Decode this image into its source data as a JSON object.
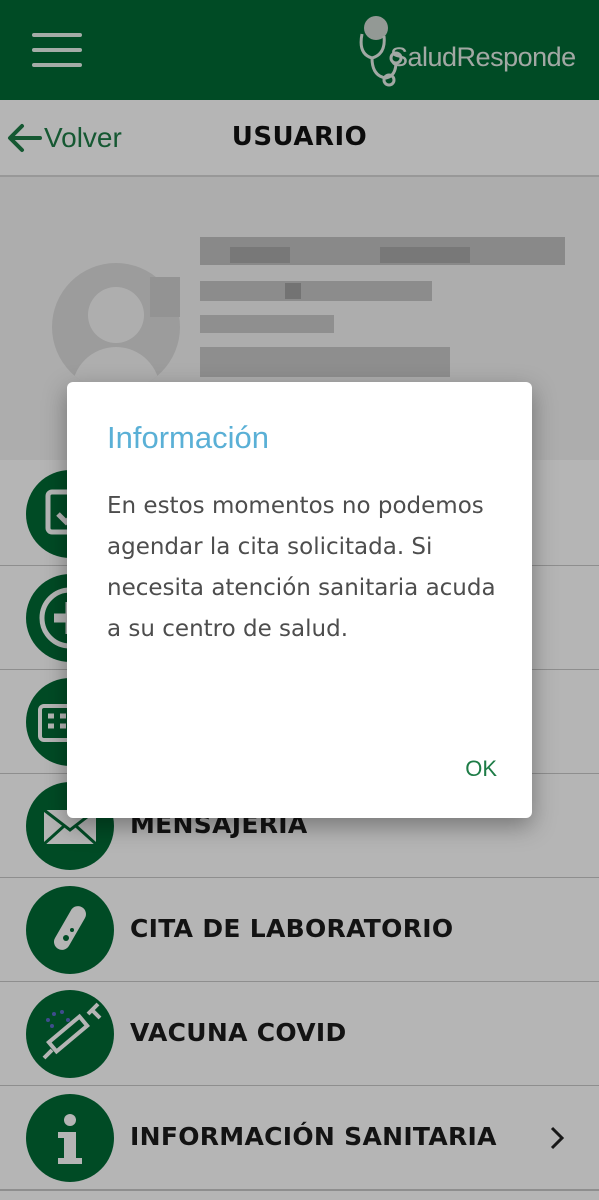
{
  "app": {
    "brand": "SaludResponde"
  },
  "header": {
    "back_label": "Volver",
    "title": "USUARIO"
  },
  "menu": {
    "items": [
      {
        "label": ""
      },
      {
        "label": ""
      },
      {
        "label": ""
      },
      {
        "label": "MENSAJERÍA"
      },
      {
        "label": "CITA DE LABORATORIO"
      },
      {
        "label": "VACUNA COVID"
      },
      {
        "label": "INFORMACIÓN SANITARIA"
      }
    ]
  },
  "dialog": {
    "title": "Información",
    "message": "En estos momentos no podemos agendar la cita solicitada. Si necesita atención sanitaria acuda a su centro de salud.",
    "ok_label": "OK"
  },
  "colors": {
    "brand_green": "#006a35",
    "title_blue": "#5ab0d6",
    "link_green": "#1e7c47"
  }
}
